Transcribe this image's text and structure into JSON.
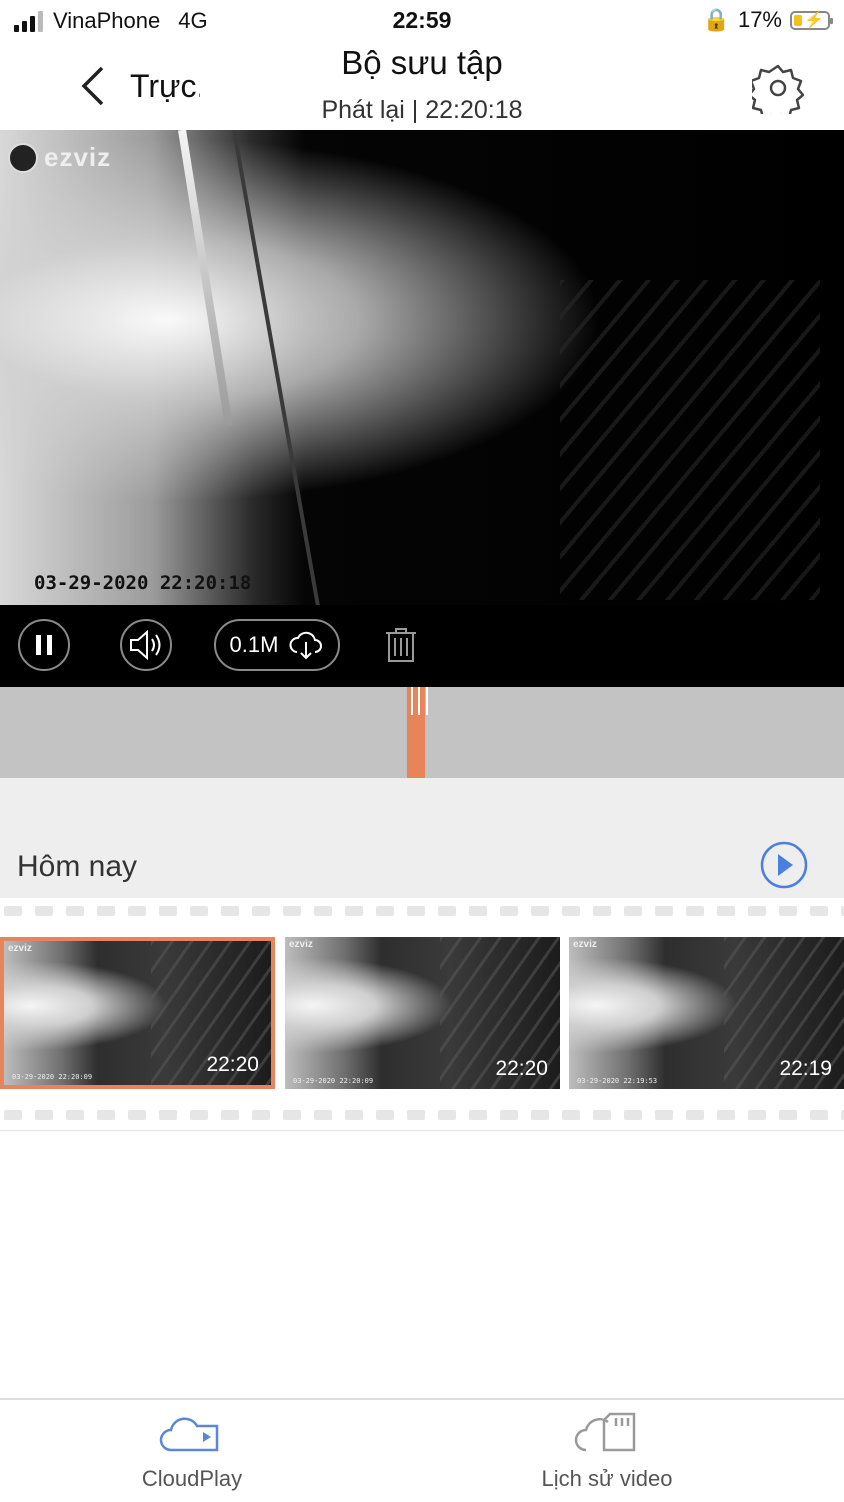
{
  "status_bar": {
    "carrier": "VinaPhone",
    "network": "4G",
    "time": "22:59",
    "battery": "17%"
  },
  "nav": {
    "back_label": "Trực.",
    "title": "Bộ sưu tập",
    "subtitle": "Phát lại | 22:20:18"
  },
  "video": {
    "brand": "ezviz",
    "timestamp": "03-29-2020 22:20:18"
  },
  "controls": {
    "download_size": "0.1M"
  },
  "section": {
    "label": "Hôm nay"
  },
  "clips": [
    {
      "time": "22:20",
      "stamp": "03-29-2020 22:20:09",
      "selected": true
    },
    {
      "time": "22:20",
      "stamp": "03-29-2020 22:20:09",
      "selected": false
    },
    {
      "time": "22:19",
      "stamp": "03-29-2020 22:19:53",
      "selected": false
    }
  ],
  "tabs": [
    {
      "label": "CloudPlay"
    },
    {
      "label": "Lịch sử video"
    }
  ],
  "colors": {
    "accent": "#e8845a",
    "play_blue": "#4a7fe0",
    "cloud_blue": "#5a87d8"
  }
}
